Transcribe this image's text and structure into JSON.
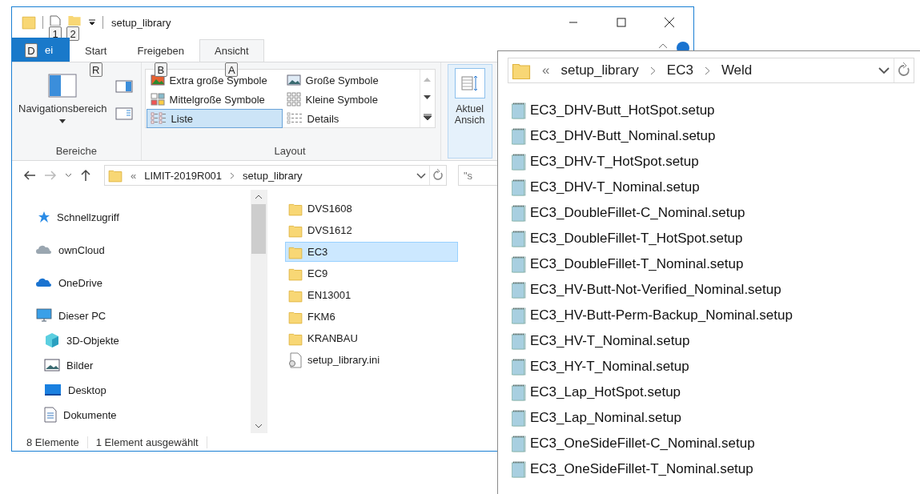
{
  "window": {
    "title": "setup_library",
    "quick_access_keytips": [
      "1",
      "2"
    ]
  },
  "ribbon": {
    "tabs": [
      {
        "label": "ei",
        "kind": "file",
        "keytip": "D",
        "selected": false
      },
      {
        "label": "Start",
        "kind": "tab",
        "keytip": "R",
        "selected": false
      },
      {
        "label": "Freigeben",
        "kind": "tab",
        "keytip": "B",
        "selected": false
      },
      {
        "label": "Ansicht",
        "kind": "tab",
        "keytip": "A",
        "selected": true
      }
    ],
    "panes_group": {
      "button": "Navigationsbereich",
      "label": "Bereiche"
    },
    "layout_group": {
      "label": "Layout",
      "items": [
        {
          "label": "Extra große Symbole",
          "kind": "xl",
          "selected": false
        },
        {
          "label": "Große Symbole",
          "kind": "large",
          "selected": false
        },
        {
          "label": "Mittelgroße Symbole",
          "kind": "medium",
          "selected": false
        },
        {
          "label": "Kleine Symbole",
          "kind": "small",
          "selected": false
        },
        {
          "label": "Liste",
          "kind": "list",
          "selected": true
        },
        {
          "label": "Details",
          "kind": "details",
          "selected": false
        }
      ]
    },
    "current_view_group": {
      "button_lines": [
        "Aktuel",
        "Ansich"
      ]
    }
  },
  "address": {
    "overflow": "«",
    "crumbs": [
      "LIMIT-2019R001",
      "setup_library"
    ]
  },
  "search": {
    "placeholder": "\"s"
  },
  "nav_pane": [
    {
      "label": "Schnellzugriff",
      "kind": "star"
    },
    {
      "label": "ownCloud",
      "kind": "owncloud"
    },
    {
      "label": "OneDrive",
      "kind": "onedrive"
    },
    {
      "label": "Dieser PC",
      "kind": "pc",
      "children": [
        {
          "label": "3D-Objekte",
          "kind": "cube"
        },
        {
          "label": "Bilder",
          "kind": "pictures"
        },
        {
          "label": "Desktop",
          "kind": "desktop"
        },
        {
          "label": "Dokumente",
          "kind": "documents"
        }
      ]
    }
  ],
  "files": [
    {
      "name": "DVS1608",
      "kind": "folder",
      "selected": false
    },
    {
      "name": "DVS1612",
      "kind": "folder",
      "selected": false
    },
    {
      "name": "EC3",
      "kind": "folder",
      "selected": true
    },
    {
      "name": "EC9",
      "kind": "folder",
      "selected": false
    },
    {
      "name": "EN13001",
      "kind": "folder",
      "selected": false
    },
    {
      "name": "FKM6",
      "kind": "folder",
      "selected": false
    },
    {
      "name": "KRANBAU",
      "kind": "folder",
      "selected": false
    },
    {
      "name": "setup_library.ini",
      "kind": "settings",
      "selected": false
    }
  ],
  "status_bar": [
    "8 Elemente",
    "1 Element ausgewählt"
  ],
  "popup": {
    "overflow": "«",
    "crumbs": [
      "setup_library",
      "EC3",
      "Weld"
    ],
    "files": [
      "EC3_DHV-Butt_HotSpot.setup",
      "EC3_DHV-Butt_Nominal.setup",
      "EC3_DHV-T_HotSpot.setup",
      "EC3_DHV-T_Nominal.setup",
      "EC3_DoubleFillet-C_Nominal.setup",
      "EC3_DoubleFillet-T_HotSpot.setup",
      "EC3_DoubleFillet-T_Nominal.setup",
      "EC3_HV-Butt-Not-Verified_Nominal.setup",
      "EC3_HV-Butt-Perm-Backup_Nominal.setup",
      "EC3_HV-T_Nominal.setup",
      "EC3_HY-T_Nominal.setup",
      "EC3_Lap_HotSpot.setup",
      "EC3_Lap_Nominal.setup",
      "EC3_OneSideFillet-C_Nominal.setup",
      "EC3_OneSideFillet-T_Nominal.setup"
    ]
  }
}
